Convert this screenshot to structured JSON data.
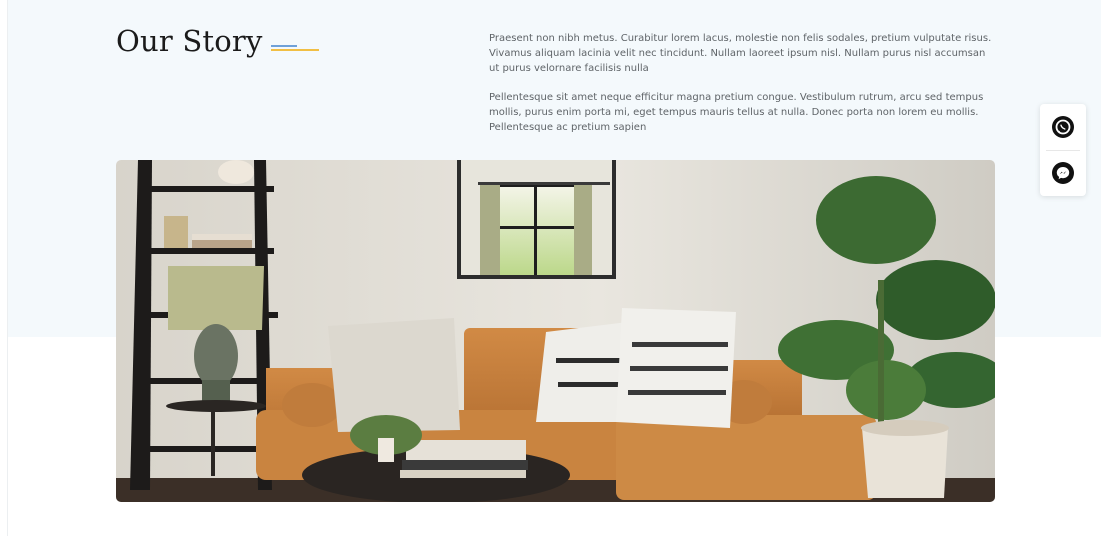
{
  "section": {
    "title": "Our Story",
    "paragraphs": [
      "Praesent non nibh metus. Curabitur lorem lacus, molestie non felis sodales, pretium vulputate risus. Vivamus aliquam lacinia velit nec tincidunt. Nullam laoreet ipsum nisl. Nullam purus nisl accumsan ut purus velornare facilisis nulla",
      "Pellentesque sit amet neque efficitur magna pretium congue. Vestibulum rutrum, arcu sed tempus mollis, purus enim porta mi, eget tempus mauris tellus at nulla. Donec porta non lorem eu mollis. Pellentesque ac pretium sapien"
    ]
  },
  "hero_image": {
    "subject": "living-room-photo"
  },
  "contact_dock": {
    "items": [
      {
        "icon": "whatsapp-icon"
      },
      {
        "icon": "messenger-icon"
      }
    ]
  },
  "colors": {
    "band_background": "#f4f9fc",
    "accent_blue": "#6fa1d8",
    "accent_yellow": "#f1bf44"
  }
}
